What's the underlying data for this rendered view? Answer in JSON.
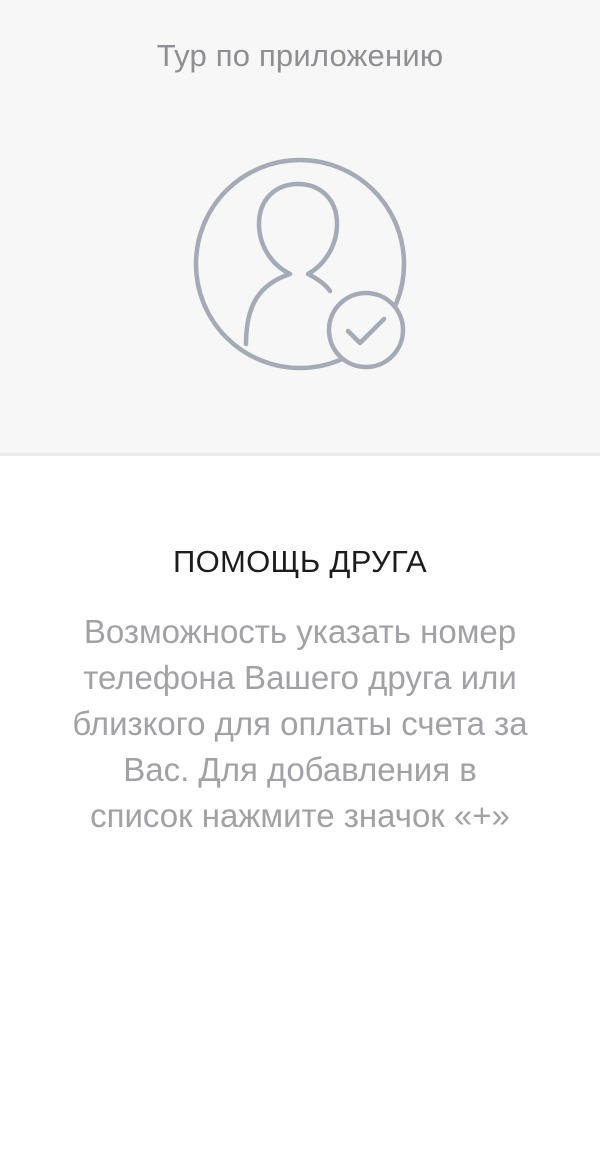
{
  "header": {
    "title": "Тур по приложению"
  },
  "illustration": {
    "icon": "user-check-icon",
    "stroke_color": "#a4abb6"
  },
  "feature": {
    "title": "ПОМОЩЬ ДРУГА",
    "description": "Возможность указать номер телефона Вашего друга или близкого для оплаты счета за Вас. Для добавления в список нажмите значок «+»"
  },
  "colors": {
    "top_background": "#f7f7f7",
    "title_text": "#1c1c1e",
    "secondary_text": "#a1a1a6"
  }
}
